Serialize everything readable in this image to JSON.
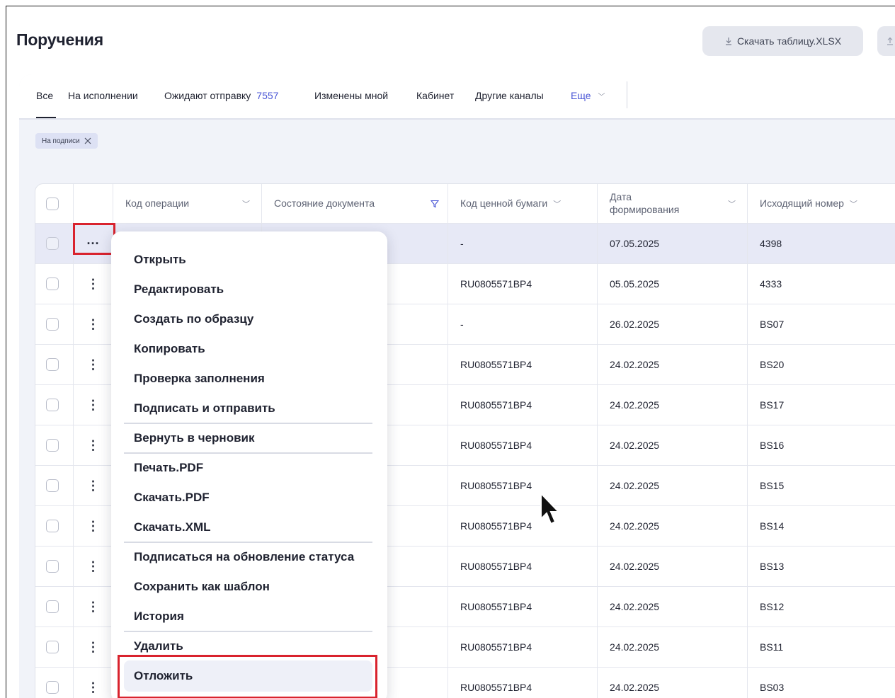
{
  "page": {
    "title": "Поручения"
  },
  "toolbar": {
    "download_label": "Скачать таблицу.XLSX",
    "download_icon": "download-icon",
    "upload_icon": "upload-icon"
  },
  "tabs": {
    "items": [
      {
        "label": "Все",
        "active": true
      },
      {
        "label": "На исполнении"
      },
      {
        "label": "Ожидают отправку",
        "count": "7557"
      },
      {
        "label": "Изменены мной"
      },
      {
        "label": "Кабинет"
      },
      {
        "label": "Другие каналы"
      }
    ],
    "more_label": "Еще"
  },
  "filters": {
    "chip_label": "На подписи"
  },
  "table": {
    "columns": [
      {
        "label": "Код операции"
      },
      {
        "label": "Состояние документа"
      },
      {
        "label": "Код ценной бумаги"
      },
      {
        "label": "Дата формирования"
      },
      {
        "label": "Исходящий номер"
      }
    ],
    "rows": [
      {
        "security": "-",
        "date": "07.05.2025",
        "number": "4398",
        "selected": true
      },
      {
        "security": "RU0805571BP4",
        "date": "05.05.2025",
        "number": "4333"
      },
      {
        "security": "-",
        "date": "26.02.2025",
        "number": "BS07"
      },
      {
        "security": "RU0805571BP4",
        "date": "24.02.2025",
        "number": "BS20"
      },
      {
        "security": "RU0805571BP4",
        "date": "24.02.2025",
        "number": "BS17"
      },
      {
        "security": "RU0805571BP4",
        "date": "24.02.2025",
        "number": "BS16"
      },
      {
        "security": "RU0805571BP4",
        "date": "24.02.2025",
        "number": "BS15"
      },
      {
        "security": "RU0805571BP4",
        "date": "24.02.2025",
        "number": "BS14"
      },
      {
        "security": "RU0805571BP4",
        "date": "24.02.2025",
        "number": "BS13"
      },
      {
        "security": "RU0805571BP4",
        "date": "24.02.2025",
        "number": "BS12"
      },
      {
        "security": "RU0805571BP4",
        "date": "24.02.2025",
        "number": "BS11"
      },
      {
        "security": "RU0805571BP4",
        "date": "24.02.2025",
        "number": "BS03"
      }
    ]
  },
  "context_menu": {
    "items": [
      "Открыть",
      "Редактировать",
      "Создать по образцу",
      "Копировать",
      "Проверка заполнения",
      "Подписать и отправить",
      "Вернуть в черновик",
      "Печать.PDF",
      "Скачать.PDF",
      "Скачать.XML",
      "Подписаться на обновление статуса",
      "Сохранить как шаблон",
      "История",
      "Удалить",
      "Отложить"
    ]
  },
  "colors": {
    "accent": "#4b57d6",
    "highlight": "#d9232e",
    "selected_row": "#e7e9f6",
    "panel_bg": "#f1f3f9"
  }
}
